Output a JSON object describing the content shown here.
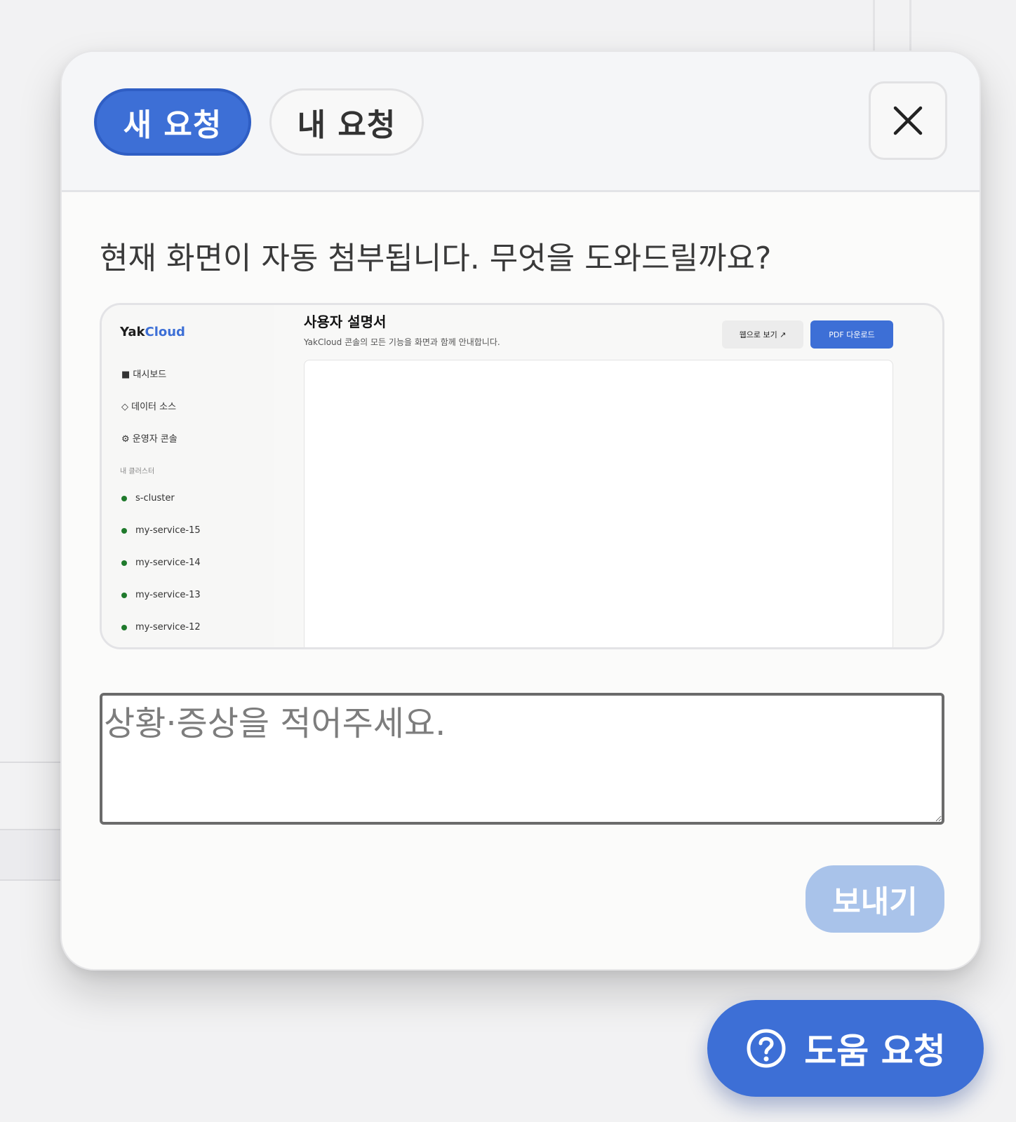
{
  "tabs": {
    "new_request": "새 요청",
    "my_requests": "내 요청"
  },
  "prompt": "현재 화면이 자동 첨부됩니다. 무엇을 도와드릴까요?",
  "screenshot_preview": {
    "logo": {
      "part1": "Yak",
      "part2": "Cloud"
    },
    "nav": [
      "■ 대시보드",
      "◇ 데이터 소스",
      "⚙ 운영자 콘솔"
    ],
    "section_label": "내 클러스터",
    "clusters": [
      "s-cluster",
      "my-service-15",
      "my-service-14",
      "my-service-13",
      "my-service-12"
    ],
    "title": "사용자 설명서",
    "subtitle": "YakCloud 콘솔의 모든 기능을 화면과 함께 안내합니다.",
    "web_view_button": "웹으로 보기 ↗",
    "pdf_button": "PDF 다운로드"
  },
  "description": {
    "placeholder": "상황·증상을 적어주세요.",
    "value": ""
  },
  "send_button": "보내기",
  "help_button": "도움 요청",
  "colors": {
    "accent": "#3d6fd6",
    "send_disabled": "#a9c3ea"
  }
}
